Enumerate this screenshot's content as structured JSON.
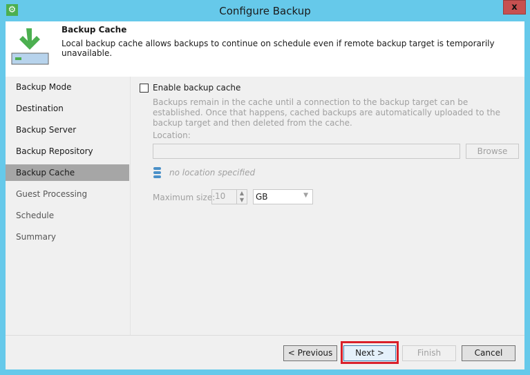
{
  "window": {
    "title": "Configure Backup",
    "close_label": "x"
  },
  "header": {
    "title": "Backup Cache",
    "description": "Local backup cache allows backups to continue on schedule even if remote backup target is temporarily unavailable."
  },
  "nav": {
    "items": [
      {
        "label": "Backup Mode"
      },
      {
        "label": "Destination"
      },
      {
        "label": "Backup Server"
      },
      {
        "label": "Backup Repository"
      },
      {
        "label": "Backup Cache",
        "selected": true
      },
      {
        "label": "Guest Processing"
      },
      {
        "label": "Schedule"
      },
      {
        "label": "Summary"
      }
    ]
  },
  "content": {
    "enable_label": "Enable backup cache",
    "enable_checked": false,
    "help": "Backups remain in the cache until a connection to the backup target can be established. Once that happens, cached backups are automatically uploaded to the backup target and then deleted from the cache.",
    "location_label": "Location:",
    "location_value": "",
    "browse_label": "Browse",
    "status_text": "no location specified",
    "max_size_label": "Maximum size:",
    "max_size_value": "10",
    "unit": "GB"
  },
  "footer": {
    "previous": "< Previous",
    "next": "Next >",
    "finish": "Finish",
    "cancel": "Cancel"
  },
  "colors": {
    "accent": "#66c9ea",
    "close": "#c75050",
    "highlight": "#d9202a"
  }
}
